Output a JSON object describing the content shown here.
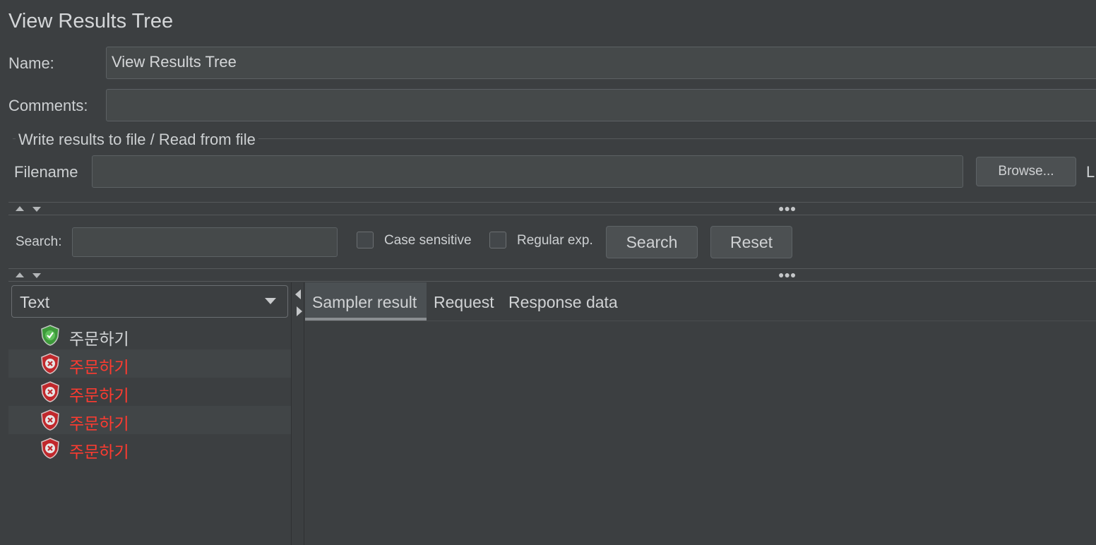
{
  "panel": {
    "title": "View Results Tree"
  },
  "name_field": {
    "label": "Name:",
    "value": "View Results Tree"
  },
  "comments_field": {
    "label": "Comments:",
    "value": ""
  },
  "file_group": {
    "legend": "Write results to file / Read from file",
    "filename_label": "Filename",
    "filename_value": "",
    "browse_label": "Browse...",
    "cut_label": "L"
  },
  "search_bar": {
    "label": "Search:",
    "value": "",
    "case_sensitive_label": "Case sensitive",
    "regex_label": "Regular exp.",
    "search_button": "Search",
    "reset_button": "Reset"
  },
  "renderer": {
    "selected": "Text"
  },
  "results": [
    {
      "label": "주문하기",
      "status": "success"
    },
    {
      "label": "주문하기",
      "status": "error"
    },
    {
      "label": "주문하기",
      "status": "error"
    },
    {
      "label": "주문하기",
      "status": "error"
    },
    {
      "label": "주문하기",
      "status": "error"
    }
  ],
  "tabs": [
    {
      "label": "Sampler result",
      "active": true
    },
    {
      "label": "Request",
      "active": false
    },
    {
      "label": "Response data",
      "active": false
    }
  ],
  "colors": {
    "background": "#3c3f41",
    "error_text": "#ff3b30",
    "success_icon": "#3d9a3a",
    "error_icon": "#c0282c",
    "tab_underline": "#8a8e91"
  }
}
